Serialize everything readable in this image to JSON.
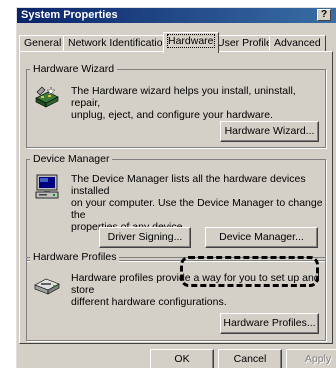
{
  "window": {
    "title": "System Properties",
    "help_label": "?"
  },
  "tabs": [
    {
      "label": "General"
    },
    {
      "label": "Network Identification"
    },
    {
      "label": "Hardware"
    },
    {
      "label": "User Profiles"
    },
    {
      "label": "Advanced"
    }
  ],
  "hardware_wizard": {
    "title": "Hardware Wizard",
    "line1": "The Hardware wizard helps you install, uninstall, repair,",
    "line2": "unplug, eject, and configure your hardware.",
    "button": "Hardware Wizard..."
  },
  "device_manager": {
    "title": "Device Manager",
    "line1": "The Device Manager lists all the hardware devices installed",
    "line2": "on your computer. Use the Device Manager to change the",
    "line3": "properties of any device.",
    "signing_button": "Driver Signing...",
    "manager_button": "Device Manager..."
  },
  "hardware_profiles": {
    "title": "Hardware Profiles",
    "line1": "Hardware profiles provide a way for you to set up and store",
    "line2": "different hardware configurations.",
    "button": "Hardware Profiles..."
  },
  "footer": {
    "ok": "OK",
    "cancel": "Cancel",
    "apply": "Apply"
  }
}
